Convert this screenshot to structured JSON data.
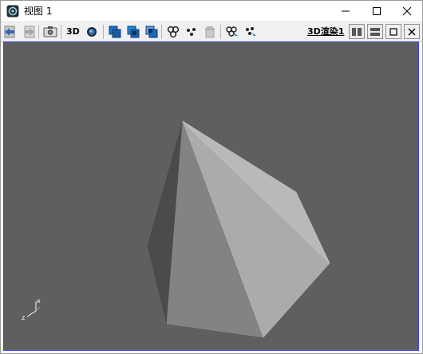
{
  "window": {
    "title": "视图 1",
    "icon": "view-app-icon"
  },
  "title_controls": {
    "minimize_icon": "minimize-icon",
    "maximize_icon": "maximize-icon",
    "close_icon": "close-icon"
  },
  "toolbar": {
    "icons": [
      "undo-view-icon",
      "redo-view-icon",
      "camera-icon",
      "3d-text",
      "sphere-icon",
      "front-icon",
      "top-icon",
      "side-icon",
      "circles-icon",
      "points-icon",
      "trash-icon",
      "select-icon",
      "select-points-icon"
    ],
    "mode_3d_label": "3D",
    "render_link": "3D渲染1",
    "right_controls": [
      "split-vertical-icon",
      "split-horizontal-icon",
      "restore-icon",
      "close-pane-icon"
    ]
  },
  "viewport": {
    "background": "#5f5f5f",
    "border": "#3d3dff",
    "axis_labels": {
      "x": "x",
      "z": "z"
    }
  }
}
